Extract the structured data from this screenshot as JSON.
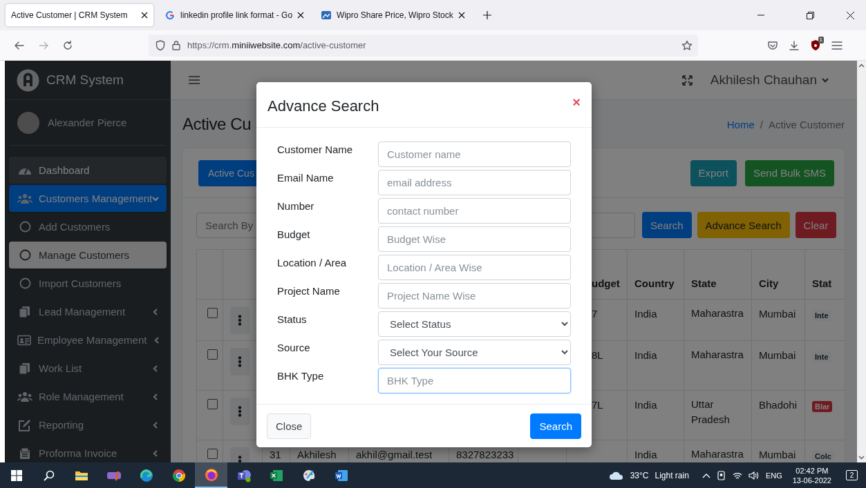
{
  "browser": {
    "tabs": [
      {
        "title": "Active Customer | CRM System",
        "selected": true
      },
      {
        "title": "linkedin profile link format - Go",
        "selected": false
      },
      {
        "title": "Wipro Share Price, Wipro Stock",
        "selected": false
      }
    ],
    "url": "https://crm.**miniiwebsite.com**/active-customer",
    "extension_badge": "1"
  },
  "sidebar": {
    "brand": "CRM System",
    "user": "Alexander Pierce",
    "items": [
      {
        "label": "Dashboard",
        "kind": "link",
        "selected": false,
        "hovered": true
      },
      {
        "label": "Customers Management",
        "kind": "menu",
        "selected": true,
        "hovered": false,
        "expanded": true,
        "children": [
          {
            "label": "Add Customers",
            "selected": false
          },
          {
            "label": "Manage Customers",
            "selected": true
          },
          {
            "label": "Import Customers",
            "selected": false
          }
        ]
      },
      {
        "label": "Lead Management",
        "kind": "menu",
        "selected": false,
        "hovered": false,
        "expanded": false
      },
      {
        "label": "Employee Management",
        "kind": "menu",
        "selected": false,
        "hovered": false,
        "expanded": false
      },
      {
        "label": "Work List",
        "kind": "menu",
        "selected": false,
        "hovered": false,
        "expanded": false
      },
      {
        "label": "Role Management",
        "kind": "menu",
        "selected": false,
        "hovered": false,
        "expanded": false
      },
      {
        "label": "Reporting",
        "kind": "menu",
        "selected": false,
        "hovered": false,
        "expanded": false
      },
      {
        "label": "Proforma Invoice",
        "kind": "menu",
        "selected": false,
        "hovered": false,
        "expanded": false
      }
    ]
  },
  "header": {
    "user_name": "Akhilesh Chauhan"
  },
  "page": {
    "title": "Active Cu",
    "breadcrumb": [
      {
        "label": "Home",
        "link": true
      },
      {
        "label": "Active Customer",
        "link": false
      }
    ],
    "breadcrumb_separator": "/"
  },
  "card": {
    "tab_button": "Active Cus",
    "actions": [
      {
        "label": "Export",
        "kind": "info"
      },
      {
        "label": "Send Bulk SMS",
        "kind": "success"
      }
    ],
    "search": {
      "placeholder": "Search By"
    },
    "search_buttons": [
      {
        "label": "Search",
        "kind": "primary"
      },
      {
        "label": "Advance Search",
        "kind": "warning"
      },
      {
        "label": "Clear",
        "kind": "danger"
      }
    ]
  },
  "table": {
    "columns": [
      {
        "label": "udget"
      },
      {
        "label": "Country"
      },
      {
        "label": "State"
      },
      {
        "label": "City"
      },
      {
        "label": "Stat"
      }
    ],
    "rows": [
      {
        "checked": false,
        "budget": "7",
        "country": "India",
        "state": "Maharastra",
        "city": "Mumbai",
        "status": {
          "label": "Inte",
          "kind": "light"
        }
      },
      {
        "checked": false,
        "budget": "8L",
        "country": "India",
        "state": "Maharastra",
        "city": "Mumbai",
        "status": {
          "label": "Inte",
          "kind": "light"
        }
      },
      {
        "checked": false,
        "budget": "7L",
        "country": "India",
        "state": "Uttar Pradesh",
        "city": "Bhadohi",
        "status": {
          "label": "Blar",
          "kind": "danger"
        }
      },
      {
        "checked": false,
        "column_3": "31",
        "column_4": "Akhilesh",
        "column_5": "akhil@gmail.test",
        "column_6": "8327823233",
        "country": "India",
        "state": "Maharastra",
        "city": "Mumbai",
        "status": {
          "label": "Colc",
          "kind": "light"
        }
      }
    ]
  },
  "modal": {
    "title": "Advance Search",
    "close_glyph": "×",
    "fields": [
      {
        "label": "Customer Name",
        "kind": "input",
        "placeholder": "Customer name",
        "focused": false
      },
      {
        "label": "Email Name",
        "kind": "input",
        "placeholder": "email address",
        "focused": false
      },
      {
        "label": "Number",
        "kind": "input",
        "placeholder": "contact number",
        "focused": false
      },
      {
        "label": "Budget",
        "kind": "input",
        "placeholder": "Budget Wise",
        "focused": false
      },
      {
        "label": "Location / Area",
        "kind": "input",
        "placeholder": "Location / Area Wise",
        "focused": false
      },
      {
        "label": "Project Name",
        "kind": "input",
        "placeholder": "Project Name Wise",
        "focused": false
      },
      {
        "label": "Status",
        "kind": "select",
        "value": "Select Status",
        "focused": false
      },
      {
        "label": "Source",
        "kind": "select",
        "value": "Select Your Source",
        "focused": false
      },
      {
        "label": "BHK Type",
        "kind": "input",
        "placeholder": "BHK Type",
        "focused": true
      }
    ],
    "buttons": [
      {
        "label": "Close",
        "kind": "secondary"
      },
      {
        "label": "Search",
        "kind": "primary"
      }
    ]
  },
  "taskbar": {
    "apps": [
      {
        "active": false
      },
      {
        "active": false
      },
      {
        "active": false
      },
      {
        "active": false
      },
      {
        "active": false
      },
      {
        "active": false
      },
      {
        "active": true
      },
      {
        "active": false
      },
      {
        "active": false
      },
      {
        "active": false
      },
      {
        "active": false
      }
    ],
    "temperature": "33°C",
    "weather": "Light rain",
    "language": "ENG",
    "time": "02:42 PM",
    "date": "13-06-2022",
    "notifications": "2"
  }
}
